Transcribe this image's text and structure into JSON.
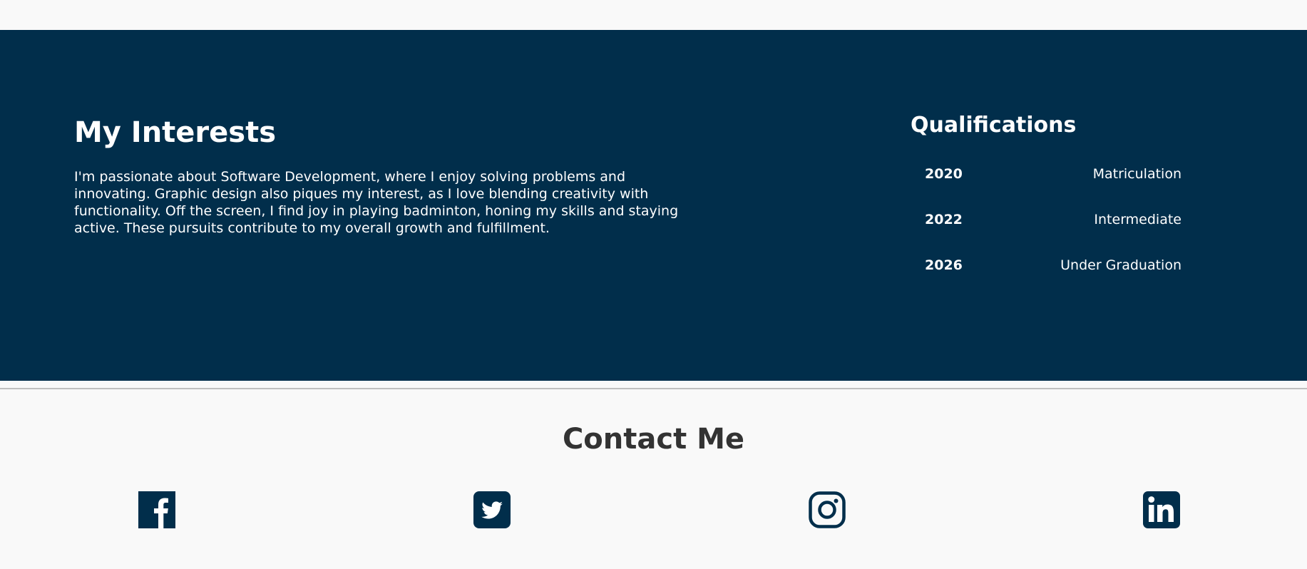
{
  "about": {
    "interests_title": "My Interests",
    "interests_text": "I'm passionate about Software Development, where I enjoy solving problems and innovating. Graphic design also piques my interest, as I love blending creativity with functionality. Off the screen, I find joy in playing badminton, honing my skills and staying active. These pursuits contribute to my overall growth and fulfillment.",
    "qualifications_title": "Qualifications",
    "qualifications": [
      {
        "year": "2020",
        "title": "Matriculation"
      },
      {
        "year": "2022",
        "title": "Intermediate"
      },
      {
        "year": "2026",
        "title": "Under Graduation"
      }
    ]
  },
  "contact": {
    "title": "Contact Me",
    "icons": [
      "facebook-icon",
      "twitter-icon",
      "instagram-icon",
      "linkedin-icon"
    ]
  },
  "colors": {
    "primary": "#012e4b",
    "background": "#f9f9f9",
    "heading_dark": "#333333",
    "text_light": "#ffffff"
  }
}
